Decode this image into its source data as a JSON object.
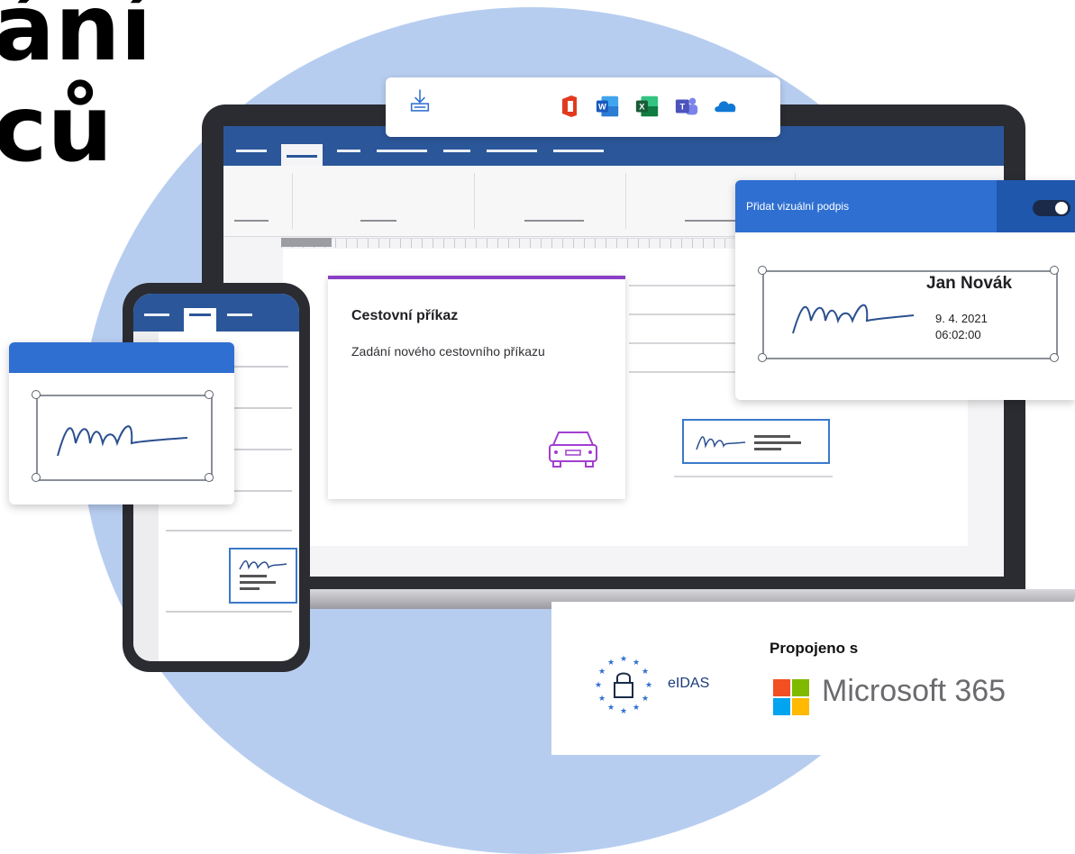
{
  "headline": {
    "text": "ání\nců"
  },
  "toolbar": {
    "icons": [
      "download-icon",
      "office-icon",
      "word-icon",
      "excel-icon",
      "teams-icon",
      "onedrive-icon"
    ]
  },
  "document_card": {
    "title": "Cestovní příkaz",
    "subtitle": "Zadání nového cestovního příkazu",
    "icon": "car-icon"
  },
  "signature_panel": {
    "label": "Přidat vizuální podpis",
    "toggle_on": true,
    "signer_name": "Jan Novák",
    "date": "9. 4. 2021",
    "time": "06:02:00"
  },
  "badges": {
    "eidas_label": "eIDAS",
    "connected_label": "Propojeno s",
    "microsoft_label": "Microsoft 365"
  },
  "colors": {
    "word_blue": "#2b579a",
    "accent_blue": "#2f6fd1",
    "card_accent": "#8a3fc5",
    "blob": "#b7cdf0"
  }
}
